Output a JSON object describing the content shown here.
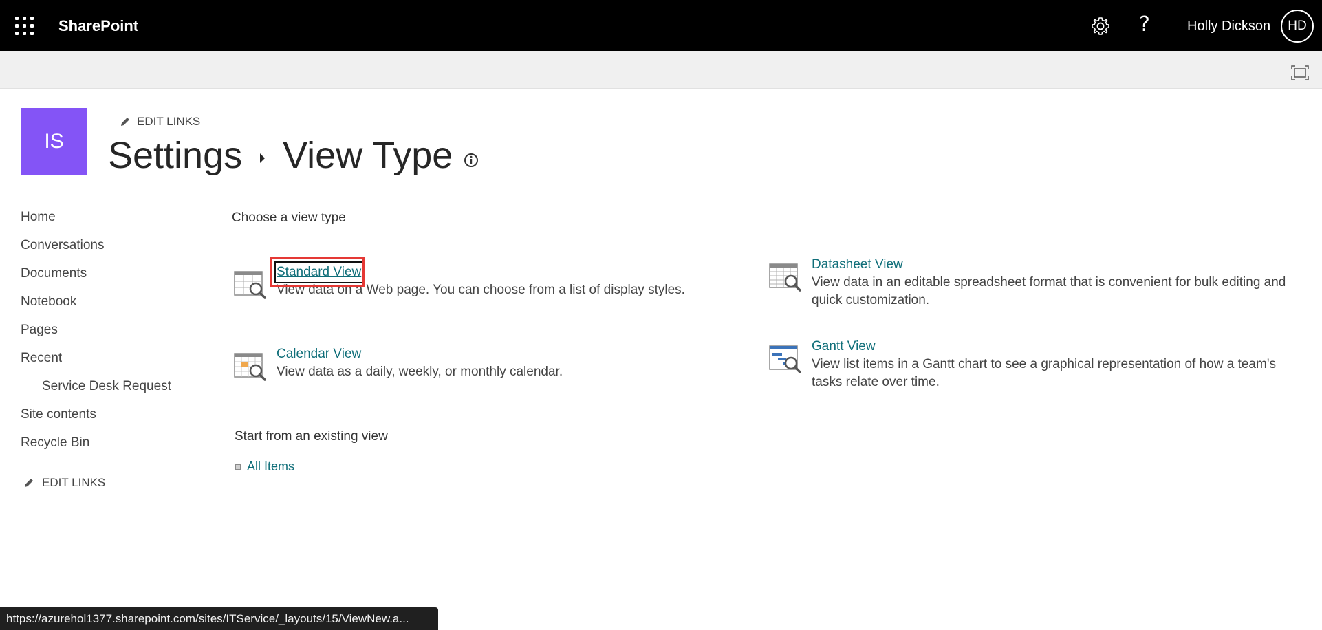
{
  "suite": {
    "brand": "SharePoint",
    "user_name": "Holly Dickson",
    "avatar_initials": "HD",
    "icons": [
      "app-launcher-icon",
      "settings-gear-icon",
      "help-icon"
    ]
  },
  "ribbon": {
    "icon": "focus-mode-icon"
  },
  "site": {
    "logo_initials": "IS",
    "logo_color": "#8454f6",
    "edit_links": "EDIT LINKS",
    "breadcrumb": [
      "Settings",
      "View Type"
    ]
  },
  "nav": {
    "items": [
      "Home",
      "Conversations",
      "Documents",
      "Notebook",
      "Pages",
      "Recent",
      "Service Desk Request",
      "Site contents",
      "Recycle Bin"
    ],
    "edit_links": "EDIT LINKS"
  },
  "main": {
    "heading": "Choose a view type",
    "views": [
      {
        "label": "Standard View",
        "description": "View data on a Web page. You can choose from a list of display styles.",
        "icon": "standard-view-icon"
      },
      {
        "label": "Calendar View",
        "description": "View data as a daily, weekly, or monthly calendar.",
        "icon": "calendar-view-icon"
      },
      {
        "label": "Datasheet View",
        "description": "View data in an editable spreadsheet format that is convenient for bulk editing and quick customization.",
        "icon": "datasheet-view-icon"
      },
      {
        "label": "Gantt View",
        "description": "View list items in a Gantt chart to see a graphical representation of how a team's tasks relate over time.",
        "icon": "gantt-view-icon"
      }
    ],
    "existing_heading": "Start from an existing view",
    "existing_views": [
      "All Items"
    ]
  },
  "status_bar": {
    "url": "https://azurehol1377.sharepoint.com/sites/ITService/_layouts/15/ViewNew.a..."
  },
  "colors": {
    "suite_bar": "#000000",
    "link": "#0f6e79",
    "highlight": "#e53935"
  }
}
